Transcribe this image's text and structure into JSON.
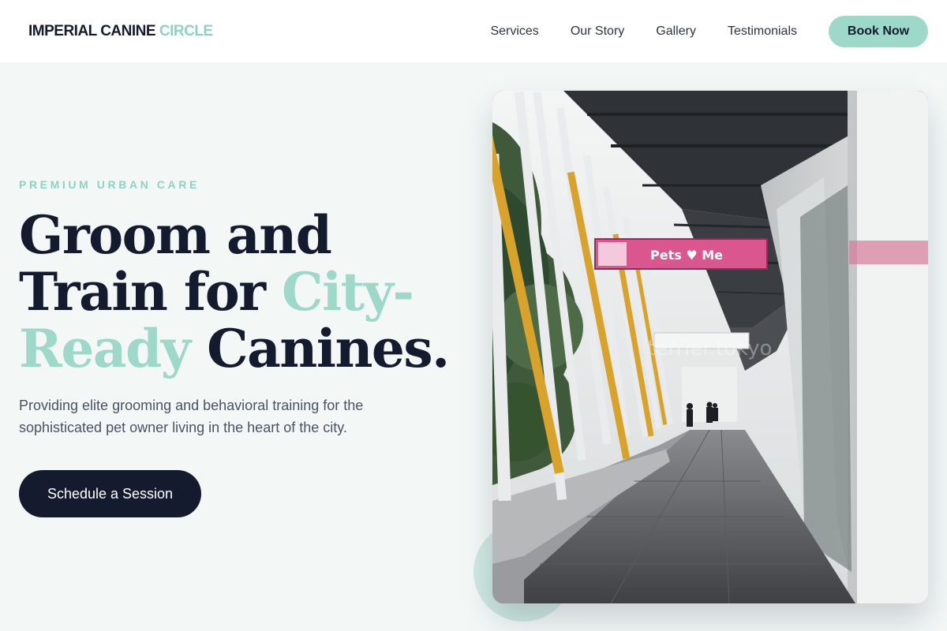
{
  "header": {
    "logo_main": "IMPERIAL CANINE",
    "logo_accent": "CIRCLE",
    "nav": [
      "Services",
      "Our Story",
      "Gallery",
      "Testimonials"
    ],
    "book_label": "Book Now"
  },
  "hero": {
    "eyebrow": "PREMIUM URBAN CARE",
    "headline_line1": "Groom and",
    "headline_line2a": "Train for ",
    "headline_line2b": "City-",
    "headline_line3a": "Ready",
    "headline_line3b": " Canines.",
    "subtitle": "Providing elite grooming and behavioral training for the sophisticated pet owner living in the heart of the city.",
    "cta_label": "Schedule a Session"
  },
  "photo": {
    "sign_text": "Pets ♥ Me",
    "watermark": "terrier.tokyo"
  },
  "colors": {
    "accent": "#9ed8c9",
    "dark": "#141b2e",
    "background": "#f3f8f7"
  }
}
